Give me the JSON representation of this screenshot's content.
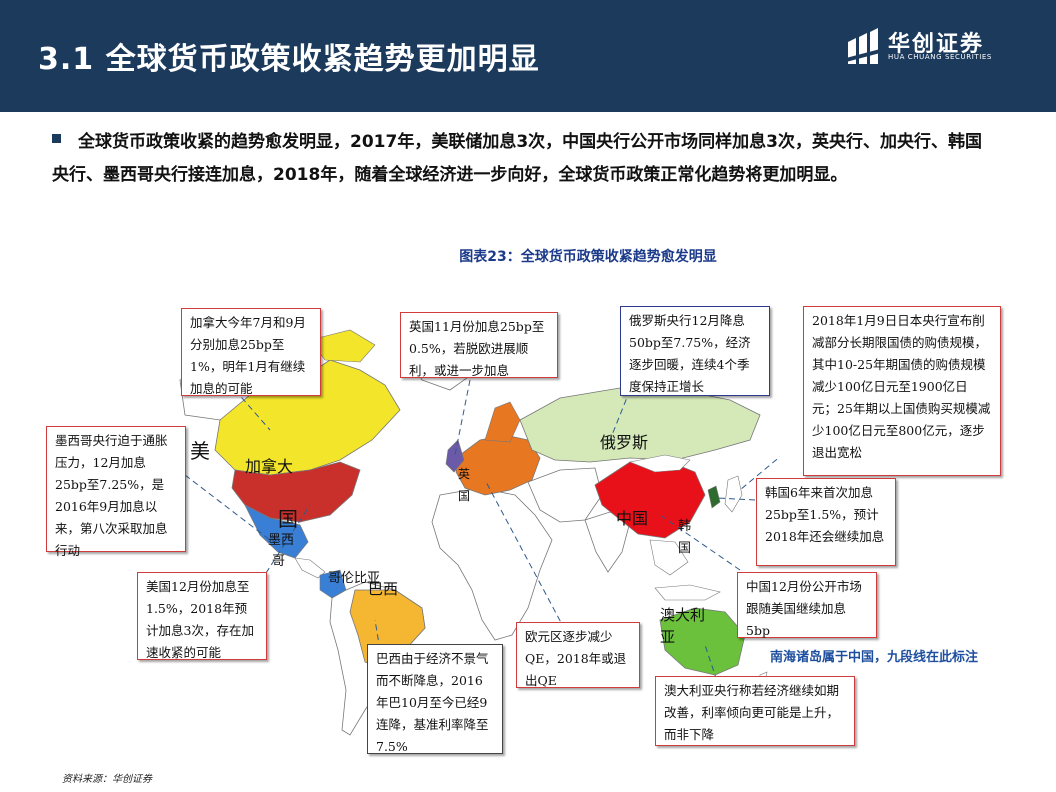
{
  "header": {
    "title": "3.1 全球货币政策收紧趋势更加明显",
    "logo_cn": "华创证券",
    "logo_en": "HUA CHUANG SECURITIES"
  },
  "intro": "全球货币政策收紧的趋势愈发明显，2017年，美联储加息3次，中国央行公开市场同样加息3次，英央行、加央行、韩国央行、墨西哥央行接连加息，2018年，随着全球经济进一步向好，全球货币政策正常化趋势将更加明显。",
  "figure_title": "图表23：全球货币政策收紧趋势愈发明显",
  "map_labels": {
    "usa_1": "美",
    "usa_2": "国",
    "canada": "加拿大",
    "mexico_1": "墨西",
    "mexico_2": "哥",
    "colombia": "哥伦比亚",
    "brazil": "巴西",
    "uk_1": "英",
    "uk_2": "国",
    "russia": "俄罗斯",
    "china": "中国",
    "korea_1": "韩",
    "korea_2": "国",
    "australia_1": "澳大利",
    "australia_2": "亚"
  },
  "callouts": {
    "canada": "加拿大今年7月和9月分别加息25bp至1%，明年1月有继续加息的可能",
    "uk": "英国11月份加息25bp至0.5%，若脱欧进展顺利，或进一步加息",
    "russia": "俄罗斯央行12月降息50bp至7.75%，经济逐步回暖，连续4个季度保持正增长",
    "japan": "2018年1月9日日本央行宣布削减部分长期限国债的购债规模，其中10-25年期国债的购债规模减少100亿日元至1900亿日元；25年期以上国债购买规模减少100亿日元至800亿元，逐步退出宽松",
    "mexico": "墨西哥央行迫于通胀压力，12月加息25bp至7.25%，是2016年9月加息以来，第八次采取加息行动",
    "korea": "韩国6年来首次加息25bp至1.5%，预计2018年还会继续加息",
    "usa": "美国12月份加息至1.5%，2018年预计加息3次，存在加速收紧的可能",
    "euro": "欧元区逐步减少QE，2018年或退出QE",
    "china": "中国12月份公开市场跟随美国继续加息5bp",
    "brazil": "巴西由于经济不景气而不断降息，2016年巴10月至今已经9连降，基准利率降至7.5%",
    "australia": "澳大利亚央行称若经济继续如期改善，利率倾向更可能是上升，而非下降"
  },
  "south_sea_note": "南海诸岛属于中国，九段线在此标注",
  "source": "资料来源：华创证券",
  "colors": {
    "header_bg": "#1b3a5c",
    "callout_border": "#d23b3b",
    "usa": "#c9302c",
    "canada": "#f2e52a",
    "china": "#e8111a",
    "russia": "#d4e8b8",
    "brazil": "#f5b731",
    "australia": "#6bc13c",
    "europe": "#e87722",
    "uk": "#6a5aa8",
    "mexico": "#3a7fd6",
    "land": "#ffffff",
    "note": "#1e4f9e"
  }
}
